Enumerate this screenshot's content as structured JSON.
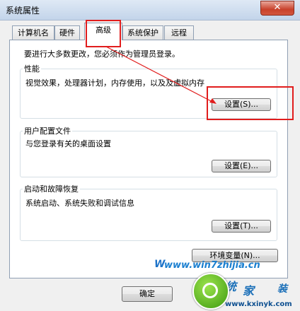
{
  "window": {
    "title": "系统属性",
    "close_label": "✕"
  },
  "tabs": [
    {
      "label": "计算机名"
    },
    {
      "label": "硬件"
    },
    {
      "label": "高级"
    },
    {
      "label": "系统保护"
    },
    {
      "label": "远程"
    }
  ],
  "notice": "要进行大多数更改，您必须作为管理员登录。",
  "performance": {
    "title": "性能",
    "description": "视觉效果，处理器计划，内存使用，以及及虚拟内存",
    "button": "设置(S)..."
  },
  "user_profiles": {
    "title": "用户配置文件",
    "description": "与您登录有关的桌面设置",
    "button": "设置(E)..."
  },
  "startup_recovery": {
    "title": "启动和故障恢复",
    "description": "系统启动、系统失败和调试信息",
    "button": "设置(T)..."
  },
  "env_button": "环境变量(N)...",
  "ok_button": "确定",
  "watermark": {
    "top": "www.win7zhijia.cn",
    "bottom": "www.kxinyk.com",
    "logo_w": "W",
    "logo_chars": "系统家",
    "logo_char2": "统",
    "logo_char3": "家",
    "logo_char4": "装"
  },
  "colors": {
    "highlight": "#e11d1d",
    "watermark": "#1a7fd0"
  }
}
